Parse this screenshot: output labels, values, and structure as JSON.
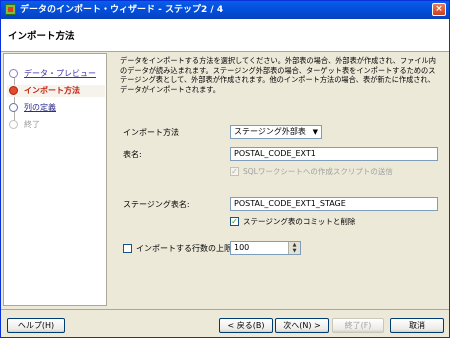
{
  "window": {
    "title": "データのインポート・ウィザード - ステップ2 / 4",
    "close_glyph": "×"
  },
  "header": {
    "page_title": "インポート方法"
  },
  "steps": [
    {
      "label": "データ・プレビュー",
      "state": "done"
    },
    {
      "label": "インポート方法",
      "state": "active"
    },
    {
      "label": "列の定義",
      "state": "next"
    },
    {
      "label": "終了",
      "state": "disabled"
    }
  ],
  "content": {
    "description": "データをインポートする方法を選択してください。外部表の場合、外部表が作成され、ファイル内のデータが読み込まれます。ステージング外部表の場合、ターゲット表をインポートするためのステージング表として、外部表が作成されます。他のインポート方法の場合、表が新たに作成され、データがインポートされます。",
    "import_method": {
      "label": "インポート方法",
      "value": "ステージング外部表"
    },
    "table_name": {
      "label": "表名:",
      "value": "POSTAL_CODE_EXT1"
    },
    "send_sql_script": {
      "label": "SQLワークシートへの作成スクリプトの送信",
      "checked": true,
      "enabled": false
    },
    "staging_table_name": {
      "label": "ステージング表名:",
      "value": "POSTAL_CODE_EXT1_STAGE"
    },
    "commit_delete_staging": {
      "label": "ステージング表のコミットと削除",
      "checked": true,
      "enabled": true
    },
    "row_limit": {
      "label": "インポートする行数の上限:",
      "value": "100",
      "checked": false
    }
  },
  "buttons": {
    "help": "ヘルプ(H)",
    "back": "< 戻る(B)",
    "next": "次へ(N) >",
    "finish": "終了(F)",
    "cancel": "取消"
  }
}
